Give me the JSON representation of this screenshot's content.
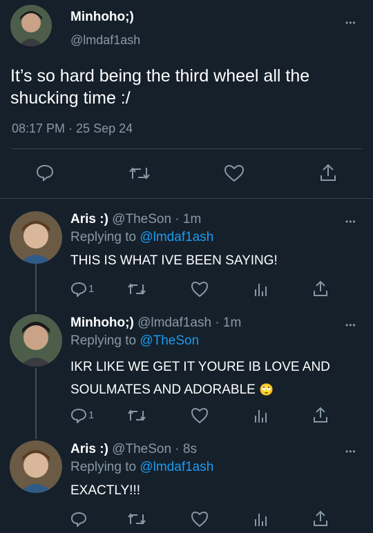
{
  "colors": {
    "background": "#15202b",
    "muted": "#8899a6",
    "link": "#1d9bf0",
    "divider": "#38444d"
  },
  "main_tweet": {
    "author_name": "Minhoho;)",
    "author_handle": "@lmdaf1ash",
    "text_line1": "It’s so hard being the third wheel all the",
    "text_line2": "shucking time :/",
    "timestamp": "08:17 PM · 25 Sep 24",
    "actions": [
      "reply-icon",
      "retweet-icon",
      "like-icon",
      "share-icon"
    ]
  },
  "replies": [
    {
      "author_name": "Aris :)",
      "meta": "@TheSon · 1m",
      "replying_prefix": "Replying to ",
      "replying_to": "@lmdaf1ash",
      "text_line1": "THIS IS WHAT IVE BEEN SAYING!",
      "reply_count": "1"
    },
    {
      "author_name": "Minhoho;)",
      "meta": "@lmdaf1ash · 1m",
      "replying_prefix": "Replying to ",
      "replying_to": "@TheSon",
      "text_line1": "IKR LIKE WE GET IT YOURE IB LOVE AND",
      "text_line2": "SOULMATES AND ADORABLE",
      "emoji": "🙄",
      "reply_count": "1"
    },
    {
      "author_name": "Aris :)",
      "meta": "@TheSon · 8s",
      "replying_prefix": "Replying to ",
      "replying_to": "@lmdaf1ash",
      "text_line1": "EXACTLY!!!",
      "reply_count": ""
    }
  ],
  "more_glyph": "•••"
}
